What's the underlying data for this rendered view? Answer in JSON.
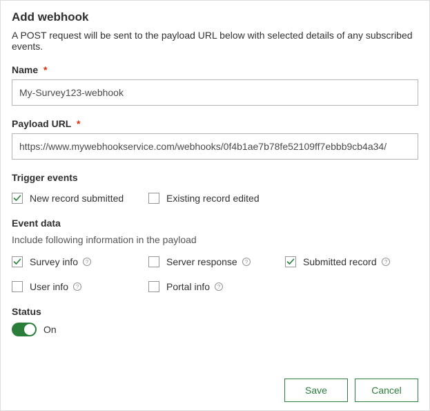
{
  "title": "Add webhook",
  "description": "A POST request will be sent to the payload URL below with selected details of any subscribed events.",
  "name": {
    "label": "Name",
    "required": true,
    "value": "My-Survey123-webhook"
  },
  "payload_url": {
    "label": "Payload URL",
    "required": true,
    "value": "https://www.mywebhookservice.com/webhooks/0f4b1ae7b78fe52109ff7ebbb9cb4a34/"
  },
  "trigger_events": {
    "label": "Trigger events",
    "options": [
      {
        "label": "New record submitted",
        "checked": true
      },
      {
        "label": "Existing record edited",
        "checked": false
      }
    ]
  },
  "event_data": {
    "label": "Event data",
    "description": "Include following information in the payload",
    "options": [
      {
        "label": "Survey info",
        "checked": true,
        "help": true
      },
      {
        "label": "Server response",
        "checked": false,
        "help": true
      },
      {
        "label": "Submitted record",
        "checked": true,
        "help": true
      },
      {
        "label": "User info",
        "checked": false,
        "help": true
      },
      {
        "label": "Portal info",
        "checked": false,
        "help": true
      }
    ]
  },
  "status": {
    "label": "Status",
    "on": true,
    "on_label": "On"
  },
  "buttons": {
    "save": "Save",
    "cancel": "Cancel"
  },
  "required_marker": "*"
}
